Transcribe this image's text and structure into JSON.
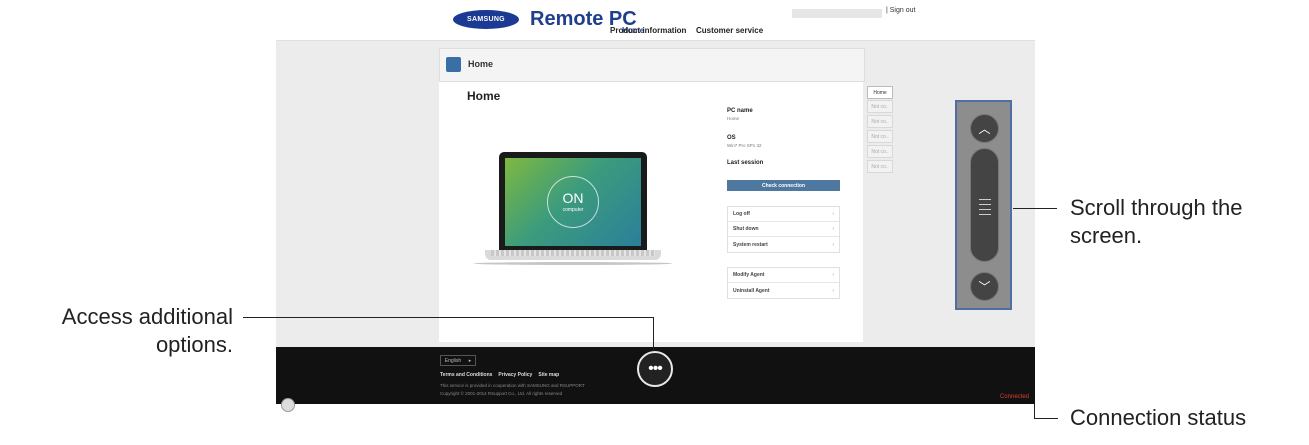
{
  "app": {
    "brand": "SAMSUNG",
    "title": "Remote PC"
  },
  "nav": {
    "home": "Home",
    "product": "Product information",
    "customer": "Customer service"
  },
  "header": {
    "sign_out": "| Sign out"
  },
  "panel": {
    "header_title": "Home",
    "title": "Home"
  },
  "laptop": {
    "state": "ON",
    "sublabel": "computer"
  },
  "info": {
    "pc_name_label": "PC name",
    "pc_name_value": "Home",
    "os_label": "OS",
    "os_value": "Win7 Pro SP1 32",
    "last_session_label": "Last session"
  },
  "buttons": {
    "check_connection": "Check connection"
  },
  "actions_power": [
    {
      "label": "Log off"
    },
    {
      "label": "Shut down"
    },
    {
      "label": "System restart"
    }
  ],
  "actions_agent": [
    {
      "label": "Modify Agent"
    },
    {
      "label": "Uninstall Agent"
    }
  ],
  "side_tabs": [
    "Home",
    "Not co..",
    "Not co..",
    "Not co..",
    "Not co..",
    "Not co.."
  ],
  "footer": {
    "language": "English",
    "links": [
      "Terms and Conditions",
      "Privacy Policy",
      "Site map"
    ],
    "note1": "This service is provided in cooperation with SAMSUNG and RSUPPORT",
    "note2": "Copyright © 2001-2014 RSupport Co., Ltd. All rights reserved"
  },
  "status": {
    "text": "Connected"
  },
  "callouts": {
    "scroll_line1": "Scroll through the",
    "scroll_line2": "screen.",
    "options_line1": "Access additional",
    "options_line2": "options.",
    "status": "Connection status"
  },
  "icons": {
    "more": "more-options-icon",
    "up": "chevron-up-icon",
    "down": "chevron-down-icon",
    "scroll": "scroll-handle-icon"
  },
  "colors": {
    "brand": "#1f3e8e",
    "status": "#d8402b",
    "highlight": "#4e6ea4",
    "button": "#4f78a0"
  }
}
